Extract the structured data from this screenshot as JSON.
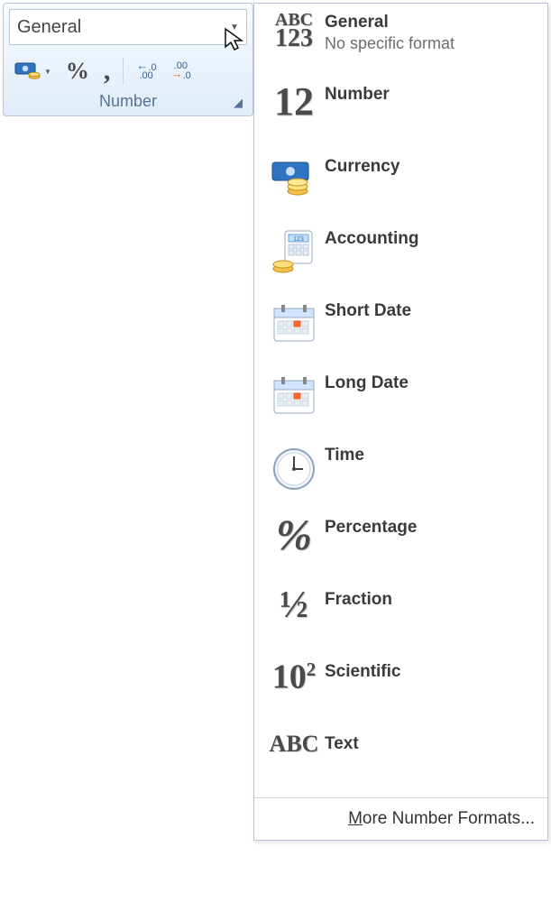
{
  "ribbon": {
    "combo_value": "General",
    "group_label": "Number",
    "accounting_btn": "Accounting Number Format",
    "percent_btn": "%",
    "comma_btn": ",",
    "increase_decimal_btn": "Increase Decimal",
    "decrease_decimal_btn": "Decrease Decimal"
  },
  "dropdown": {
    "items": [
      {
        "id": "general",
        "title": "General",
        "subtitle": "No specific format",
        "icon": "abc123"
      },
      {
        "id": "number",
        "title": "Number",
        "subtitle": "",
        "icon": "12"
      },
      {
        "id": "currency",
        "title": "Currency",
        "subtitle": "",
        "icon": "currency"
      },
      {
        "id": "accounting",
        "title": "Accounting",
        "subtitle": "",
        "icon": "accounting"
      },
      {
        "id": "shortdate",
        "title": "Short Date",
        "subtitle": "",
        "icon": "calendar"
      },
      {
        "id": "longdate",
        "title": "Long Date",
        "subtitle": "",
        "icon": "calendar"
      },
      {
        "id": "time",
        "title": "Time",
        "subtitle": "",
        "icon": "clock"
      },
      {
        "id": "percentage",
        "title": "Percentage",
        "subtitle": "",
        "icon": "percent"
      },
      {
        "id": "fraction",
        "title": "Fraction",
        "subtitle": "",
        "icon": "fraction"
      },
      {
        "id": "scientific",
        "title": "Scientific",
        "subtitle": "",
        "icon": "tenpow"
      },
      {
        "id": "text",
        "title": "Text",
        "subtitle": "",
        "icon": "abc"
      }
    ],
    "more": "More Number Formats..."
  }
}
